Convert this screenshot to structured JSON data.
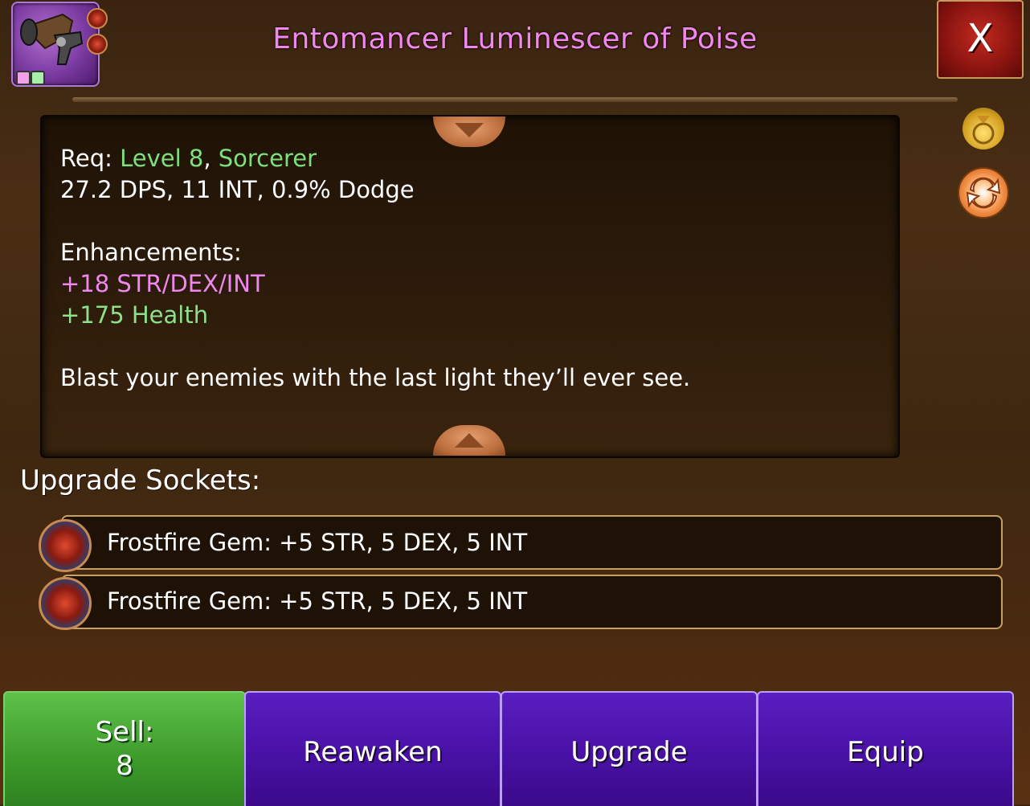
{
  "header": {
    "title": "Entomancer Luminescer of Poise",
    "close_label": "X"
  },
  "item": {
    "icon": "blaster-weapon-icon",
    "gem_colors": [
      "#f0a0e8",
      "#a8f0a8"
    ]
  },
  "description": {
    "req_label": "Req: ",
    "req_level": "Level 8",
    "req_sep": ", ",
    "req_class": "Sorcerer",
    "stats": "27.2 DPS, 11 INT, 0.9% Dodge",
    "enh_title": "Enhancements:",
    "enh_1": "+18 STR/DEX/INT",
    "enh_2": "+175 Health",
    "flavor": "Blast your enemies with the last light they’ll ever see."
  },
  "sockets": {
    "title": "Upgrade Sockets:",
    "items": [
      {
        "label": "Frostfire Gem: +5 STR, 5 DEX, 5 INT"
      },
      {
        "label": "Frostfire Gem: +5 STR, 5 DEX, 5 INT"
      }
    ]
  },
  "actions": {
    "sell_label": "Sell:",
    "sell_value": "8",
    "reawaken_label": "Reawaken",
    "upgrade_label": "Upgrade",
    "equip_label": "Equip"
  },
  "colors": {
    "title": "#ee88ee",
    "requirement": "#7ee07a",
    "enhancement_stat": "#ee88ee",
    "enhancement_health": "#8ee08a",
    "sell_button": "#4cae36",
    "action_button": "#4a12a8",
    "close_button": "#a81c16"
  }
}
